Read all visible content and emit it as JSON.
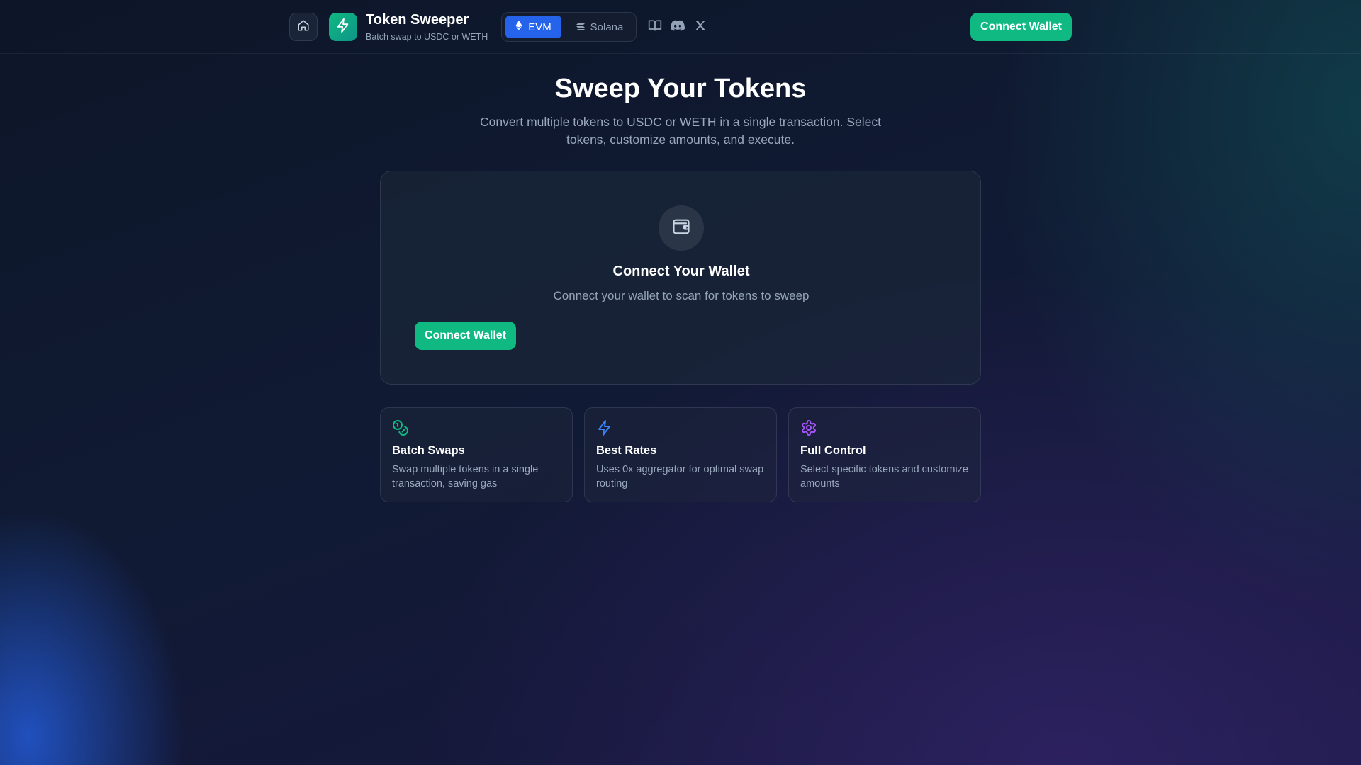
{
  "header": {
    "home_icon": "home-icon",
    "logo_icon": "lightning-bolt-icon",
    "title": "Token Sweeper",
    "subtitle": "Batch swap to USDC or WETH",
    "chain_toggle": {
      "selected": "EVM",
      "options": [
        {
          "label": "EVM",
          "icon": "ethereum-icon"
        },
        {
          "label": "Solana",
          "icon": "solana-icon"
        }
      ]
    },
    "social_icons": [
      "docs-book-icon",
      "discord-icon",
      "x-twitter-icon"
    ],
    "connect_label": "Connect Wallet"
  },
  "hero": {
    "title": "Sweep Your Tokens",
    "description": "Convert multiple tokens to USDC or WETH in a single transaction. Select tokens, customize amounts, and execute."
  },
  "wallet_card": {
    "icon": "wallet-icon",
    "title": "Connect Your Wallet",
    "description": "Connect your wallet to scan for tokens to sweep",
    "connect_label": "Connect Wallet"
  },
  "features": [
    {
      "icon": "coins-icon",
      "title": "Batch Swaps",
      "description": "Swap multiple tokens in a single transaction, saving gas",
      "color": "#10b981"
    },
    {
      "icon": "lightning-bolt-icon",
      "title": "Best Rates",
      "description": "Uses 0x aggregator for optimal swap routing",
      "color": "#3b82f6"
    },
    {
      "icon": "gear-icon",
      "title": "Full Control",
      "description": "Select specific tokens and customize amounts",
      "color": "#a855f7"
    }
  ],
  "colors": {
    "accent_green": "#10b981",
    "accent_blue": "#2563eb",
    "accent_purple": "#a855f7",
    "background": "#0f172a"
  }
}
